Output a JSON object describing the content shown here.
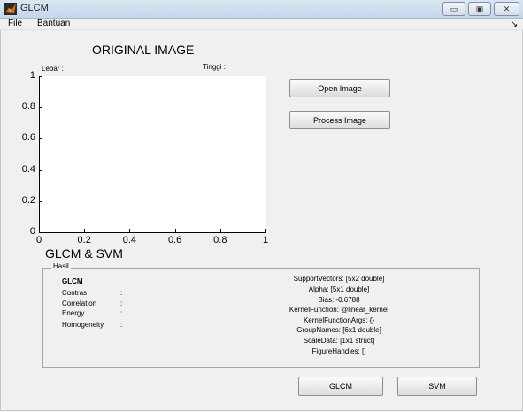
{
  "window": {
    "title": "GLCM",
    "minimize_glyph": "▭",
    "maximize_glyph": "▣",
    "close_glyph": "✕"
  },
  "menu": {
    "items": [
      "File",
      "Bantuan"
    ],
    "arrow_glyph": "↘"
  },
  "image_section": {
    "title": "ORIGINAL IMAGE",
    "width_label": "Lebar :",
    "height_label": "Tinggi :"
  },
  "axes": {
    "x_ticks": [
      "0",
      "0.2",
      "0.4",
      "0.6",
      "0.8",
      "1"
    ],
    "y_ticks": [
      "0",
      "0.2",
      "0.4",
      "0.6",
      "0.8",
      "1"
    ]
  },
  "buttons": {
    "open_image": "Open Image",
    "process_image": "Process Image",
    "glcm": "GLCM",
    "svm": "SVM"
  },
  "results": {
    "section_title": "GLCM & SVM",
    "panel_title": "Hasil",
    "glcm_title": "GLCM",
    "features": [
      {
        "name": "Contras",
        "sep": ":"
      },
      {
        "name": "Correlation",
        "sep": ":"
      },
      {
        "name": "Energy",
        "sep": ":"
      },
      {
        "name": "Homogeneity",
        "sep": ":"
      }
    ],
    "svm_struct": [
      "SupportVectors: [5x2 double]",
      "Alpha: [5x1 double]",
      "Bias: -0.6788",
      "KernelFunction: @linear_kernel",
      "KernelFunctionArgs: {}",
      "GroupNames: [6x1 double]",
      "ScaleData: [1x1 struct]",
      "FigureHandles: []"
    ]
  }
}
